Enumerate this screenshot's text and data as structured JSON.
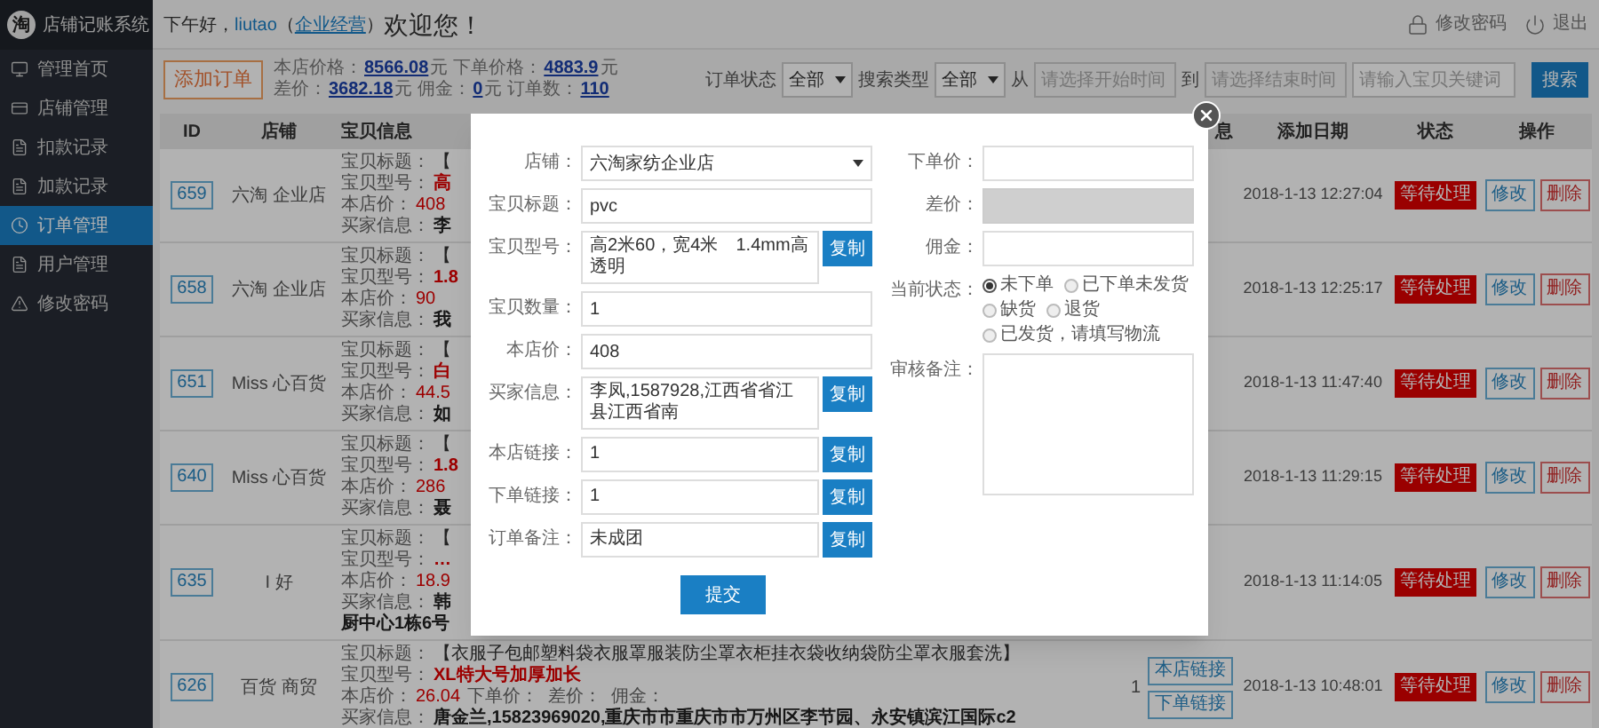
{
  "app": {
    "logo": "淘",
    "title": "店铺记账系统"
  },
  "header": {
    "greeting": "下午好，",
    "user": "liutao",
    "open": "（",
    "role": "企业经营",
    "close": "）",
    "welcome": "欢迎您！",
    "actions": [
      {
        "kind": "lock",
        "label": "修改密码"
      },
      {
        "kind": "power",
        "label": "退出"
      }
    ]
  },
  "sidebar": {
    "items": [
      {
        "kind": "monitor",
        "label": "管理首页",
        "selected": false
      },
      {
        "kind": "card",
        "label": "店铺管理",
        "selected": false
      },
      {
        "kind": "doc",
        "label": "扣款记录",
        "selected": false
      },
      {
        "kind": "doc",
        "label": "加款记录",
        "selected": false
      },
      {
        "kind": "clock",
        "label": "订单管理",
        "selected": true
      },
      {
        "kind": "doc",
        "label": "用户管理",
        "selected": false
      },
      {
        "kind": "warning",
        "label": "修改密码",
        "selected": false
      }
    ]
  },
  "toolbar": {
    "add_button": "添加订单",
    "stats": [
      {
        "label": "本店价格：",
        "value": "8566.08",
        "unit": "元"
      },
      {
        "label": "下单价格：",
        "value": "4883.9",
        "unit": "元"
      },
      {
        "label": "差价：",
        "value": "3682.18",
        "unit": "元"
      },
      {
        "label": "佣金：",
        "value": "0",
        "unit": "元"
      },
      {
        "label": "订单数：",
        "value": "110"
      }
    ],
    "filters": [
      {
        "label": "订单状态",
        "value": "全部"
      },
      {
        "label": "搜索类型",
        "value": "全部"
      }
    ],
    "from_label": "从",
    "from_placeholder": "请选择开始时间",
    "to_label": "到",
    "to_placeholder": "请选择结束时间",
    "keyword_placeholder": "请输入宝贝关键词",
    "search_button": "搜索"
  },
  "table": {
    "columns": [
      "ID",
      "店铺",
      "宝贝信息",
      "息",
      "添加日期",
      "状态",
      "操作"
    ],
    "rows": [
      {
        "id": "659",
        "shop": "六淘 企业店",
        "lines": [
          {
            "kind": "title",
            "label": "宝贝标题：",
            "value": "【"
          },
          {
            "kind": "model",
            "label": "宝贝型号：",
            "value": "高"
          },
          {
            "kind": "price",
            "label": "本店价：",
            "value": "408"
          },
          {
            "kind": "buyer",
            "label": "买家信息：",
            "value": "李"
          }
        ],
        "date": "2018-1-13 12:27:04",
        "status": "等待处理",
        "actions": [
          "修改",
          "删除"
        ]
      },
      {
        "id": "658",
        "shop": "六淘 企业店",
        "lines": [
          {
            "kind": "title",
            "label": "宝贝标题：",
            "value": "【"
          },
          {
            "kind": "model",
            "label": "宝贝型号：",
            "value": "1.8"
          },
          {
            "kind": "price",
            "label": "本店价：",
            "value": "90"
          },
          {
            "kind": "buyer",
            "label": "买家信息：",
            "value": "我"
          }
        ],
        "date": "2018-1-13 12:25:17",
        "status": "等待处理",
        "actions": [
          "修改",
          "删除"
        ]
      },
      {
        "id": "651",
        "shop": "Miss 心百货",
        "lines": [
          {
            "kind": "title",
            "label": "宝贝标题：",
            "value": "【"
          },
          {
            "kind": "model",
            "label": "宝贝型号：",
            "value": "白"
          },
          {
            "kind": "price",
            "label": "本店价：",
            "value": "44.5"
          },
          {
            "kind": "buyer",
            "label": "买家信息：",
            "value": "如"
          }
        ],
        "date": "2018-1-13 11:47:40",
        "status": "等待处理",
        "actions": [
          "修改",
          "删除"
        ]
      },
      {
        "id": "640",
        "shop": "Miss 心百货",
        "lines": [
          {
            "kind": "title",
            "label": "宝贝标题：",
            "value": "【"
          },
          {
            "kind": "model",
            "label": "宝贝型号：",
            "value": "1.8"
          },
          {
            "kind": "price",
            "label": "本店价：",
            "value": "286"
          },
          {
            "kind": "buyer",
            "label": "买家信息：",
            "value": "聂"
          }
        ],
        "date": "2018-1-13 11:29:15",
        "status": "等待处理",
        "actions": [
          "修改",
          "删除"
        ]
      },
      {
        "id": "635",
        "shop": "I 好",
        "lines": [
          {
            "kind": "title",
            "label": "宝贝标题：",
            "value": "【"
          },
          {
            "kind": "model",
            "label": "宝贝型号：",
            "value": "…"
          },
          {
            "kind": "price",
            "label": "本店价：",
            "value": "18.9"
          },
          {
            "kind": "buyer",
            "label": "买家信息：",
            "value": "韩"
          },
          {
            "kind": "continuation",
            "value": "厨中心1栋6号"
          }
        ],
        "date": "2018-1-13 11:14:05",
        "status": "等待处理",
        "actions": [
          "修改",
          "删除"
        ]
      },
      {
        "id": "626",
        "shop": "百货 商贸",
        "lines": [
          {
            "kind": "title",
            "label": "宝贝标题：",
            "value": "【衣服子包邮塑料袋衣服罩服装防尘罩衣柜挂衣袋收纳袋防尘罩衣服套洗】"
          },
          {
            "kind": "model",
            "label": "宝贝型号：",
            "value": "XL特大号加厚加长"
          },
          {
            "kind": "price",
            "label": "本店价：",
            "value": "26.04",
            "rest": "下单价：  差价：  佣金："
          },
          {
            "kind": "buyer",
            "label": "买家信息：",
            "value": "唐金兰,15823969020,重庆市市重庆市市万州区李节园、永安镇滨江国际c2"
          }
        ],
        "count": "1",
        "links": [
          "本店链接",
          "下单链接"
        ],
        "date": "2018-1-13 10:48:01",
        "status": "等待处理",
        "actions": [
          "修改",
          "删除"
        ]
      }
    ]
  },
  "modal": {
    "left": [
      {
        "kind": "select",
        "label": "店铺：",
        "value": "六淘家纺企业店"
      },
      {
        "kind": "text",
        "label": "宝贝标题：",
        "value": "pvc"
      },
      {
        "kind": "copy",
        "label": "宝贝型号：",
        "value": "高2米60，宽4米　1.4mm高透明",
        "button": "复制"
      },
      {
        "kind": "text",
        "label": "宝贝数量：",
        "value": "1"
      },
      {
        "kind": "text",
        "label": "本店价：",
        "value": "408"
      },
      {
        "kind": "copy",
        "label": "买家信息：",
        "value": "李凤,1587928,江西省省江县江西省南",
        "button": "复制"
      },
      {
        "kind": "copy",
        "label": "本店链接：",
        "value": "1",
        "button": "复制"
      },
      {
        "kind": "copy",
        "label": "下单链接：",
        "value": "1",
        "button": "复制"
      },
      {
        "kind": "copy",
        "label": "订单备注：",
        "value": "未成团",
        "button": "复制"
      }
    ],
    "right": [
      {
        "kind": "text",
        "label": "下单价："
      },
      {
        "kind": "disabled",
        "label": "差价："
      },
      {
        "kind": "text",
        "label": "佣金："
      },
      {
        "kind": "radio",
        "label": "当前状态：",
        "options": [
          {
            "label": "未下单",
            "selected": true
          },
          {
            "label": "已下单未发货",
            "selected": false
          },
          {
            "label": "缺货",
            "selected": false
          },
          {
            "label": "退货",
            "selected": false
          },
          {
            "label": "已发货，请填写物流",
            "selected": false
          }
        ]
      },
      {
        "kind": "textarea",
        "label": "审核备注："
      }
    ],
    "submit": "提交"
  }
}
